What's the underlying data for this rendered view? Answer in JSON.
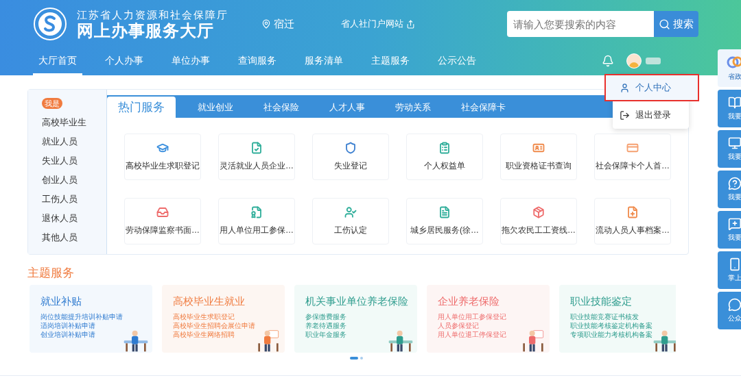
{
  "header": {
    "subtitle": "江苏省人力资源和社会保障厅",
    "title": "网上办事服务大厅",
    "location": "宿迁",
    "portal_link": "省人社门户网站",
    "search": {
      "placeholder": "请输入您要搜索的内容",
      "button": "搜索"
    }
  },
  "nav": [
    {
      "label": "大厅首页",
      "selected": true
    },
    {
      "label": "个人办事",
      "selected": false
    },
    {
      "label": "单位办事",
      "selected": false
    },
    {
      "label": "查询服务",
      "selected": false
    },
    {
      "label": "服务清单",
      "selected": false
    },
    {
      "label": "主题服务",
      "selected": false
    },
    {
      "label": "公示公告",
      "selected": false
    }
  ],
  "user_menu": [
    {
      "label": "个人中心",
      "selected": true
    },
    {
      "label": "退出登录",
      "selected": false
    }
  ],
  "identity": {
    "badge": "我是",
    "items": [
      "高校毕业生",
      "就业人员",
      "失业人员",
      "创业人员",
      "工伤人员",
      "退休人员",
      "其他人员"
    ]
  },
  "service_tabs": [
    {
      "label": "热门服务",
      "selected": true
    },
    {
      "label": "就业创业",
      "selected": false
    },
    {
      "label": "社会保险",
      "selected": false
    },
    {
      "label": "人才人事",
      "selected": false
    },
    {
      "label": "劳动关系",
      "selected": false
    },
    {
      "label": "社会保障卡",
      "selected": false
    }
  ],
  "services": [
    {
      "label": "高校毕业生求职登记",
      "color": "#3b8fde"
    },
    {
      "label": "灵活就业人员企业…",
      "color": "#2fae9a"
    },
    {
      "label": "失业登记",
      "color": "#3b7fd0"
    },
    {
      "label": "个人权益单",
      "color": "#2fae9a"
    },
    {
      "label": "职业资格证书查询",
      "color": "#f08a4b"
    },
    {
      "label": "社会保障卡个人首…",
      "color": "#f5a070"
    },
    {
      "label": "劳动保障监察书面…",
      "color": "#ee6b6b"
    },
    {
      "label": "用人单位用工参保…",
      "color": "#2fae9a"
    },
    {
      "label": "工伤认定",
      "color": "#2fae9a"
    },
    {
      "label": "城乡居民服务(徐…",
      "color": "#2fae9a"
    },
    {
      "label": "拖欠农民工工资线…",
      "color": "#ee6b6b"
    },
    {
      "label": "流动人员人事档案…",
      "color": "#f08a4b"
    }
  ],
  "theme_services": {
    "title": "主题服务",
    "cards": [
      {
        "title": "就业补贴",
        "color": "#2f7bd0",
        "items": [
          "岗位技能提升培训补贴申请",
          "适岗培训补贴申请",
          "创业培训补贴申请"
        ]
      },
      {
        "title": "高校毕业生就业",
        "color": "#f07b3f",
        "items": [
          "高校毕业生求职登记",
          "高校毕业生招聘会展位申请",
          "高校毕业生网络招聘"
        ]
      },
      {
        "title": "机关事业单位养老保险",
        "color": "#2f9d8e",
        "items": [
          "参保缴费服务",
          "养老待遇服务",
          "职业年金服务"
        ]
      },
      {
        "title": "企业养老保险",
        "color": "#ee6a6a",
        "items": [
          "用人单位用工参保登记",
          "人员参保登记",
          "用人单位退工停保登记"
        ]
      },
      {
        "title": "职业技能鉴定",
        "color": "#2f9d8e",
        "items": [
          "职业技能竞赛证书核发",
          "职业技能考核鉴定机构备案",
          "专项职业能力考核机构备案"
        ]
      }
    ],
    "pages": [
      {
        "selected": true
      },
      {
        "selected": false
      }
    ]
  },
  "side_dock": [
    "省政",
    "我要",
    "我要",
    "我要",
    "我要",
    "掌上",
    "公众"
  ]
}
